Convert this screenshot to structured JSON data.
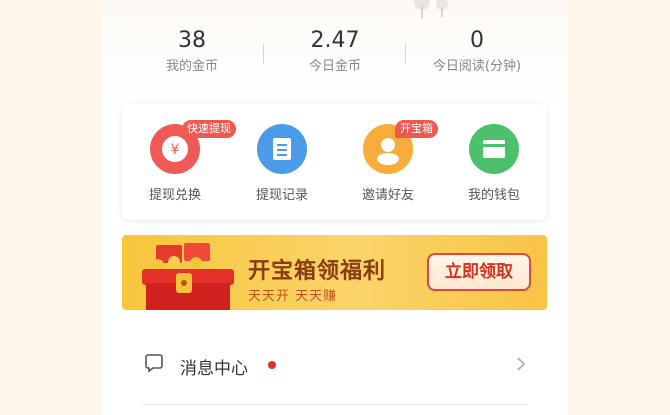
{
  "stats": [
    {
      "value": "38",
      "label": "我的金币"
    },
    {
      "value": "2.47",
      "label": "今日金币"
    },
    {
      "value": "0",
      "label": "今日阅读(分钟)"
    }
  ],
  "quick_actions": [
    {
      "label": "提现兑换",
      "badge": "快速提现",
      "icon": "yuan-coin-icon",
      "color": "#ee5a55"
    },
    {
      "label": "提现记录",
      "badge": "",
      "icon": "record-list-icon",
      "color": "#4a9be8"
    },
    {
      "label": "邀请好友",
      "badge": "开宝箱",
      "icon": "invite-friend-icon",
      "color": "#f7ad3a"
    },
    {
      "label": "我的钱包",
      "badge": "",
      "icon": "wallet-icon",
      "color": "#4cc06a"
    }
  ],
  "banner": {
    "title": "开宝箱领福利",
    "subtitle": "天天开 天天赚",
    "button": "立即领取"
  },
  "menu": {
    "messages_label": "消息中心"
  }
}
